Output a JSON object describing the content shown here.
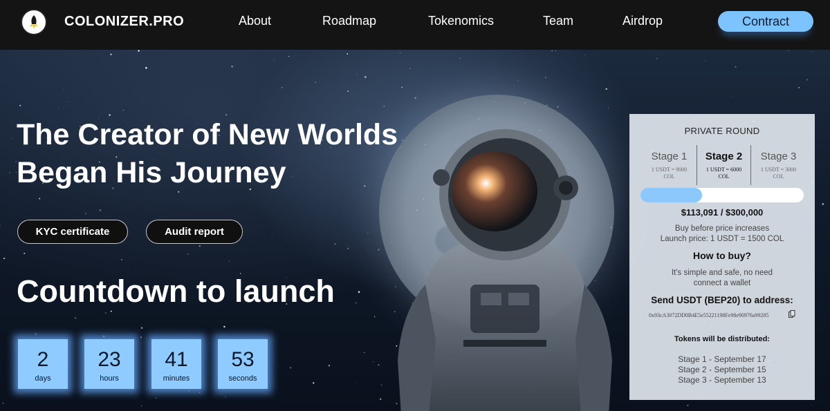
{
  "header": {
    "brand": "COLONIZER.PRO",
    "nav": [
      "About",
      "Roadmap",
      "Tokenomics",
      "Team",
      "Airdrop"
    ],
    "contract_label": "Contract"
  },
  "hero": {
    "title_line1": "The Creator of New Worlds",
    "title_line2": "Began His Journey",
    "kyc_label": "KYC certificate",
    "audit_label": "Audit report",
    "countdown_title": "Countdown to launch",
    "countdown": [
      {
        "value": "2",
        "unit": "days"
      },
      {
        "value": "23",
        "unit": "hours"
      },
      {
        "value": "41",
        "unit": "minutes"
      },
      {
        "value": "53",
        "unit": "seconds"
      }
    ]
  },
  "sale": {
    "title": "PRIVATE ROUND",
    "stages": [
      {
        "name": "Stage 1",
        "price_line1": "1 USDT = 9000",
        "price_line2": "COL"
      },
      {
        "name": "Stage 2",
        "price_line1": "1 USDT = 6000",
        "price_line2": "COL"
      },
      {
        "name": "Stage 3",
        "price_line1": "1 USDT = 3000",
        "price_line2": "COL"
      }
    ],
    "progress_fraction": 0.377,
    "raised": "$113,091 / $300,000",
    "note_line1": "Buy before price increases",
    "note_line2": "Launch price: 1 USDT = 1500 COL",
    "howto_title": "How to buy?",
    "howto_line1": "It's simple and safe, no need",
    "howto_line2": "connect a wallet",
    "send_title": "Send USDT (BEP20) to address:",
    "address": "0x93cA3072DD0B4E5e55221198Fe98e90976a99285",
    "dist_title": "Tokens will be distributed:",
    "distribution": [
      "Stage 1 - September 17",
      "Stage 2 - September 15",
      "Stage 3 - September 13"
    ]
  },
  "colors": {
    "accent": "#7cc3ff",
    "header_bg": "#141414",
    "panel_bg": "#dee4ec"
  },
  "icons": {
    "logo": "rocket-logo-icon",
    "copy": "copy-icon"
  }
}
